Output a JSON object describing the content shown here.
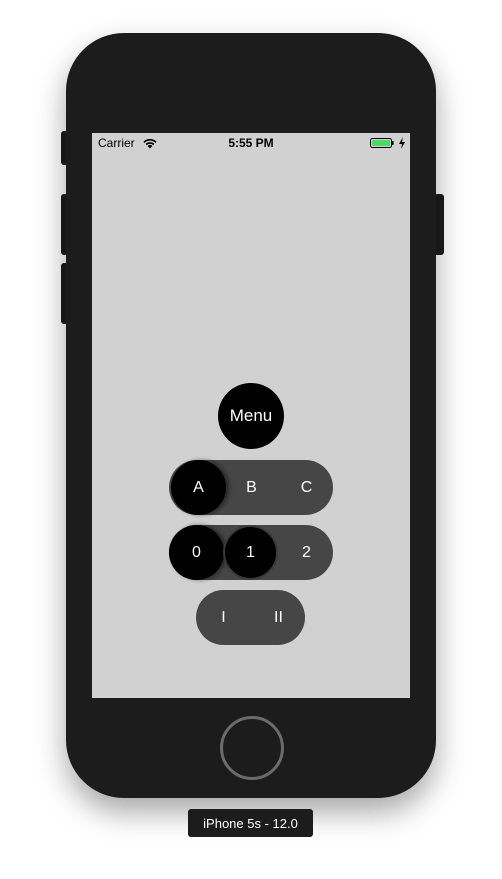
{
  "status_bar": {
    "carrier": "Carrier",
    "time": "5:55 PM",
    "wifi_icon": "wifi-icon",
    "battery_icon": "battery-icon",
    "battery_color": "#4cd964",
    "charge_icon": "bolt-icon"
  },
  "screen_background": "#d1d1d1",
  "menu": {
    "label": "Menu"
  },
  "segments_letters": {
    "items": [
      "A",
      "B",
      "C"
    ],
    "selected": "A"
  },
  "segments_numbers": {
    "items": [
      "0",
      "1",
      "2"
    ],
    "selected": [
      "0",
      "1"
    ]
  },
  "segments_roman": {
    "items": [
      "I",
      "II"
    ]
  },
  "simulator_label": "iPhone 5s - 12.0"
}
